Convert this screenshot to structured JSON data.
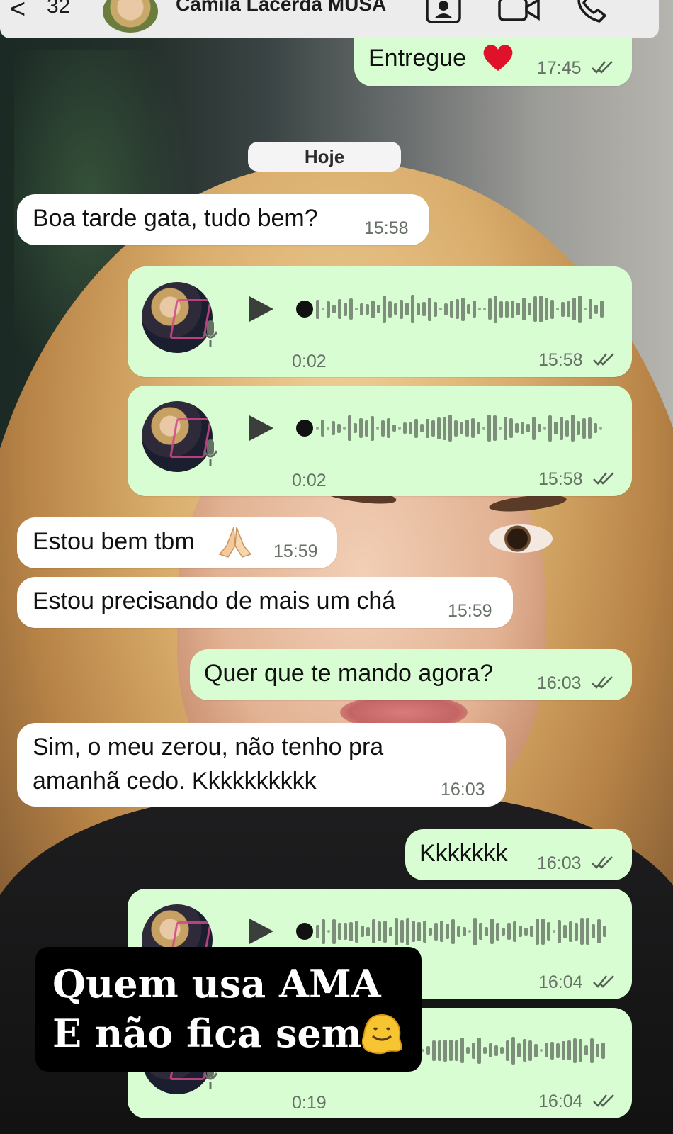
{
  "header": {
    "back_glyph": "<",
    "unread_count": "32",
    "contact_name": "Camila Lacerda MUSA",
    "icons": [
      "contact-card-icon",
      "video-call-icon",
      "phone-call-icon"
    ]
  },
  "date_separator": "Hoje",
  "messages": [
    {
      "dir": "out",
      "type": "text",
      "text": "Entregue",
      "emoji": "heart",
      "time": "17:45"
    },
    {
      "dir": "in",
      "type": "text",
      "text": "Boa tarde gata, tudo bem?",
      "time": "15:58"
    },
    {
      "dir": "out",
      "type": "audio",
      "duration": "0:02",
      "time": "15:58"
    },
    {
      "dir": "out",
      "type": "audio",
      "duration": "0:02",
      "time": "15:58"
    },
    {
      "dir": "in",
      "type": "text",
      "text": "Estou bem tbm",
      "emoji": "folded-hands",
      "time": "15:59"
    },
    {
      "dir": "in",
      "type": "text",
      "text": "Estou precisando de mais um chá",
      "time": "15:59"
    },
    {
      "dir": "out",
      "type": "text",
      "text": "Quer que te mando agora?",
      "time": "16:03"
    },
    {
      "dir": "in",
      "type": "text",
      "lines": [
        "Sim, o meu zerou, não tenho pra",
        "amanhã cedo. Kkkkkkkkkk"
      ],
      "time": "16:03"
    },
    {
      "dir": "out",
      "type": "text",
      "text": "Kkkkkkk",
      "time": "16:03"
    },
    {
      "dir": "out",
      "type": "audio",
      "duration": "",
      "time": "16:04"
    },
    {
      "dir": "out",
      "type": "audio",
      "duration": "0:19",
      "time": "16:04"
    }
  ],
  "overlay": {
    "line1": "Quem usa AMA",
    "line2": "E não fica sem",
    "emoji": "melting-face"
  },
  "colors": {
    "incoming_bubble": "#ffffff",
    "outgoing_bubble": "#d9fdd3",
    "header_bg": "#ececec",
    "overlay_bg": "#000000",
    "overlay_text": "#ffffff"
  }
}
